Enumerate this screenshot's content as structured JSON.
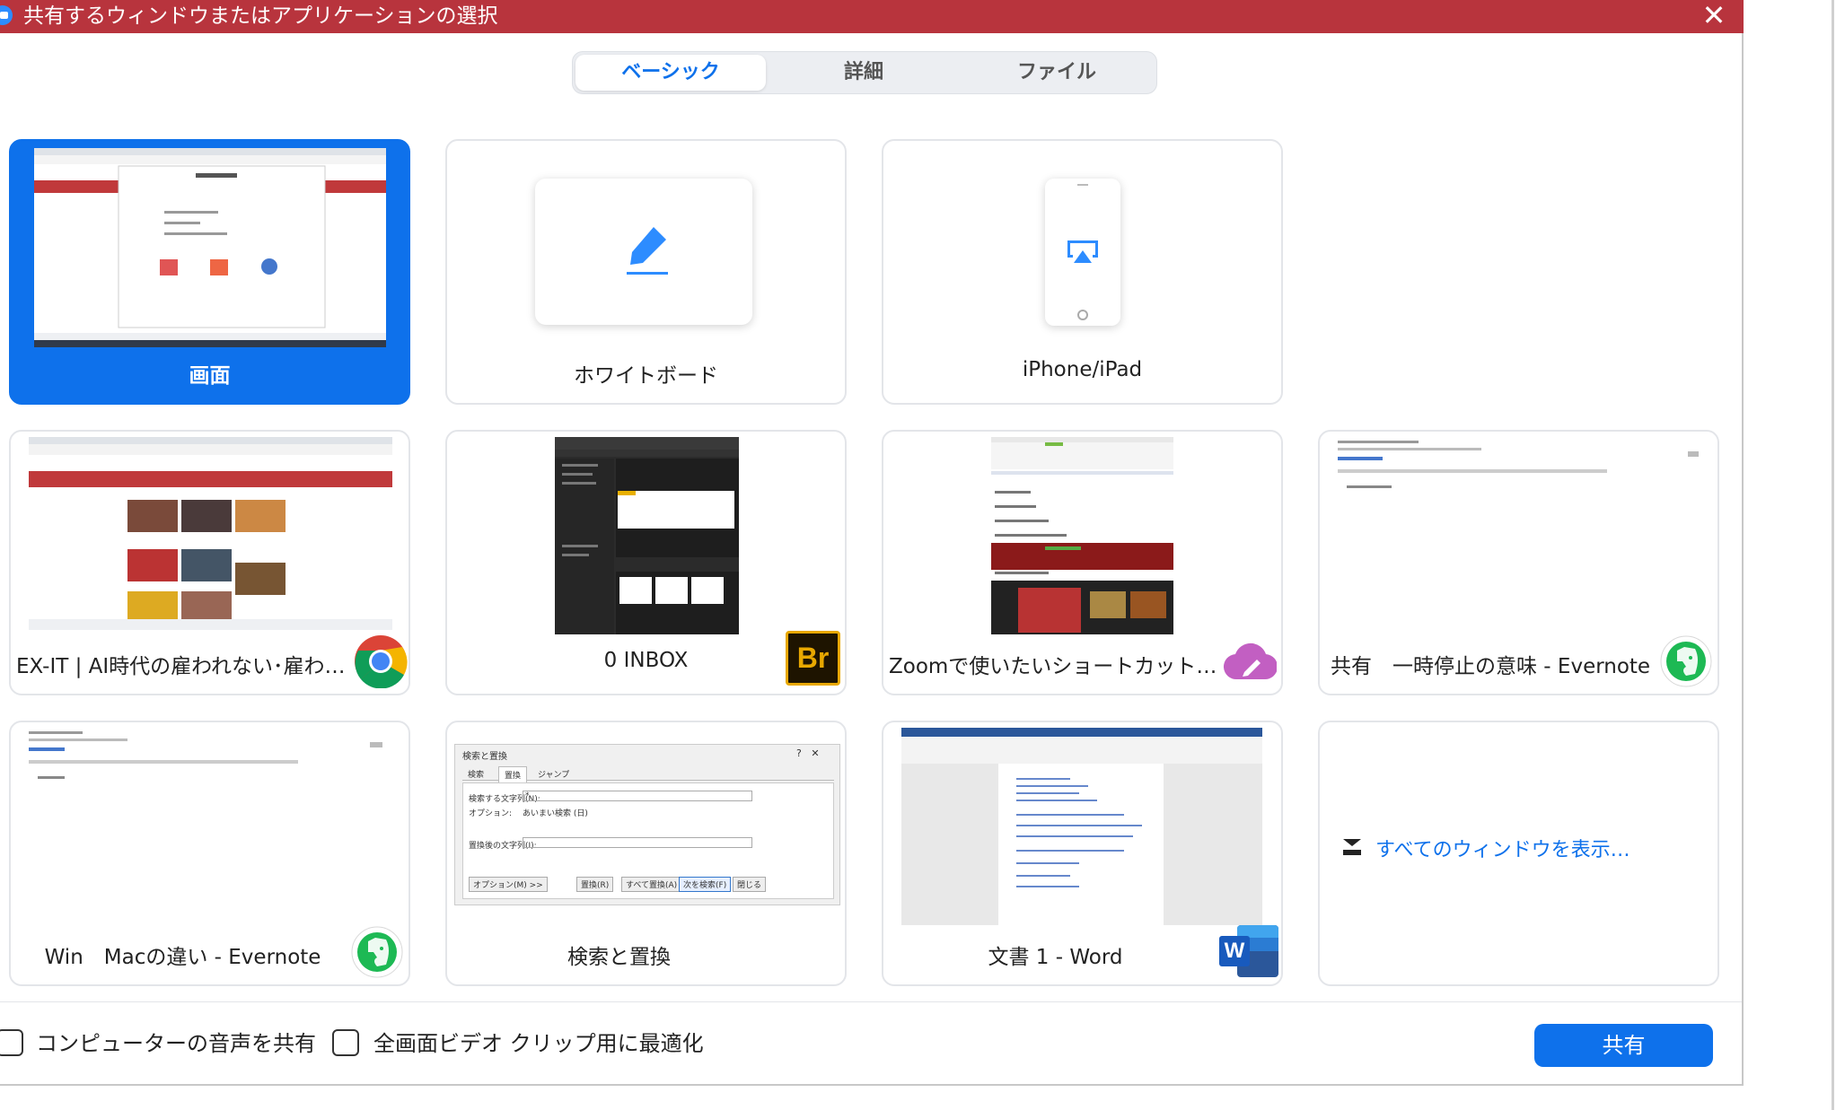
{
  "window": {
    "title": "共有するウィンドウまたはアプリケーションの選択",
    "close_glyph": "✕"
  },
  "tabs": [
    {
      "label": "ベーシック",
      "active": true
    },
    {
      "label": "詳細",
      "active": false
    },
    {
      "label": "ファイル",
      "active": false
    }
  ],
  "cards": {
    "screen": "画面",
    "whiteboard": "ホワイトボード",
    "iphone": "iPhone/iPad",
    "chrome": "EX-IT | AI時代の雇われない･雇わな…",
    "bridge": "0 INBOX",
    "zoom": "Zoomで使いたいショートカットキー - …",
    "evernote1": "共有　一時停止の意味 - Evernote",
    "evernote2": "Win　Macの違い - Evernote",
    "find_replace": "検索と置換",
    "word": "文書 1 - Word"
  },
  "badges": {
    "bridge": "Br",
    "word": "W"
  },
  "find_dialog": {
    "title": "検索と置換",
    "tabs": [
      "検索",
      "置換",
      "ジャンプ"
    ],
    "find_label": "検索する文字列(N):",
    "find_value": "*",
    "option_label": "オプション:",
    "option_value": "あいまい検索 (日)",
    "replace_label": "置換後の文字列(I):",
    "buttons": [
      "オプション(M) >>",
      "置換(R)",
      "すべて置換(A)",
      "次を検索(F)",
      "閉じる"
    ]
  },
  "show_all": "すべてのウィンドウを表示…",
  "footer": {
    "share_audio": "コンピューターの音声を共有",
    "optimize_video": "全画面ビデオ クリップ用に最適化",
    "share_button": "共有"
  },
  "colors": {
    "titlebar": "#b8343d",
    "accent": "#0e71eb"
  },
  "icons": [
    "zoom-app-icon",
    "close-icon",
    "pen-icon",
    "airplay-icon",
    "chrome-icon",
    "bridge-icon",
    "creative-cloud-icon",
    "evernote-icon",
    "word-icon",
    "expand-windows-icon"
  ]
}
